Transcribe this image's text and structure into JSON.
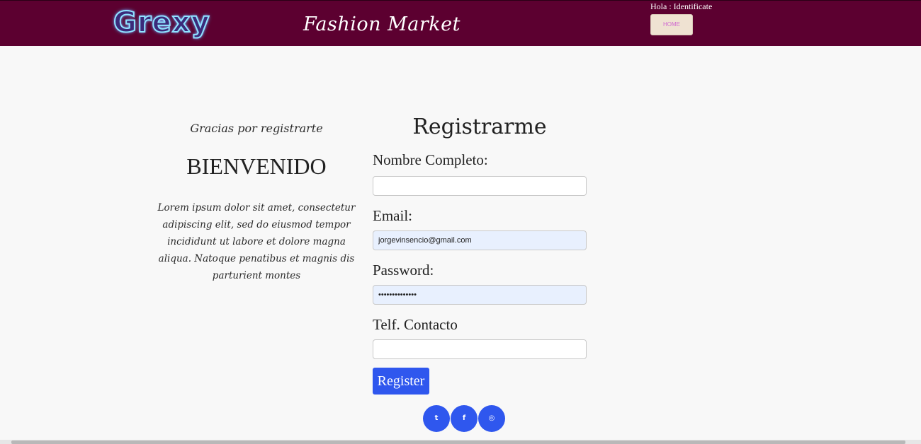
{
  "header": {
    "logo_text": "Grexy",
    "brand": "Fashion Market",
    "greeting": "Hola : Identificate",
    "home_label": "HOME"
  },
  "left": {
    "thanks": "Gracias por registrarte",
    "welcome": "BIENVENIDO",
    "description": "Lorem ipsum dolor sit amet, consectetur adipiscing elit, sed do eiusmod tempor incididunt ut labore et dolore magna aliqua. Natoque penatibus et magnis dis parturient montes"
  },
  "form": {
    "title": "Registrarme",
    "fields": [
      {
        "label": "Nombre Completo:",
        "value": ""
      },
      {
        "label": "Email:",
        "value": "jorgevinsencio@gmail.com"
      },
      {
        "label": "Password:",
        "value": "••••••••••••••"
      },
      {
        "label": "Telf. Contacto",
        "value": ""
      }
    ],
    "submit_label": "Register"
  },
  "footer": {
    "social": [
      {
        "icon": "twitter-icon",
        "glyph": "t"
      },
      {
        "icon": "facebook-icon",
        "glyph": "f"
      },
      {
        "icon": "instagram-icon",
        "glyph": "◎"
      }
    ]
  },
  "colors": {
    "header_bg": "#5c0030",
    "accent": "#2f57ee",
    "autofill_bg": "#e8f0fe"
  }
}
